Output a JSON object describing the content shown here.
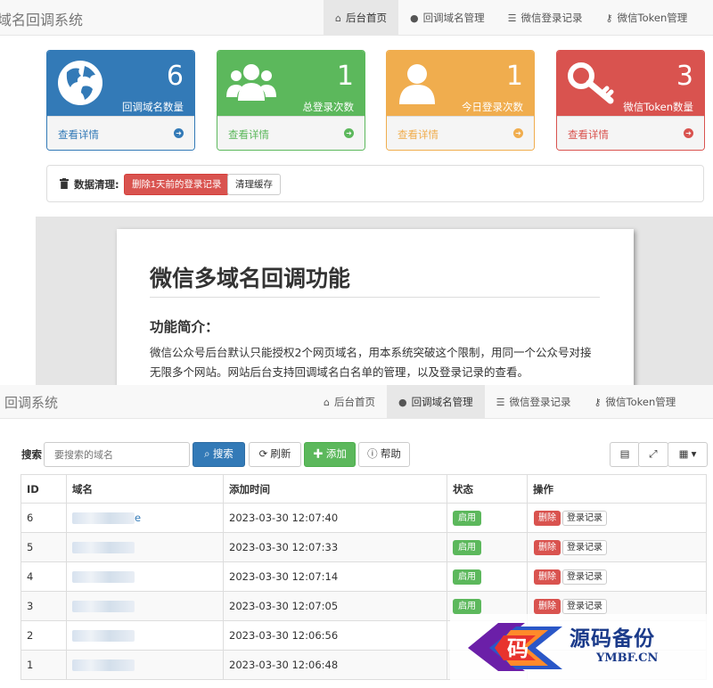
{
  "top": {
    "brand": "域名回调系统",
    "nav": [
      {
        "label": "后台首页",
        "icon": "home-icon",
        "active": true
      },
      {
        "label": "回调域名管理",
        "icon": "globe-icon",
        "active": false
      },
      {
        "label": "微信登录记录",
        "icon": "list-icon",
        "active": false
      },
      {
        "label": "微信Token管理",
        "icon": "key-icon",
        "active": false
      }
    ],
    "stats": [
      {
        "value": "6",
        "label": "回调域名数量",
        "more": "查看详情",
        "icon": "globe-icon",
        "color": "#337ab7"
      },
      {
        "value": "1",
        "label": "总登录次数",
        "more": "查看详情",
        "icon": "users-icon",
        "color": "#5cb85c"
      },
      {
        "value": "1",
        "label": "今日登录次数",
        "more": "查看详情",
        "icon": "user-icon",
        "color": "#f0ad4e"
      },
      {
        "value": "3",
        "label": "微信Token数量",
        "more": "查看详情",
        "icon": "key-icon",
        "color": "#d9534f"
      }
    ],
    "cleanup": {
      "title": "数据清理:",
      "delete_label": "删除1天前的登录记录",
      "clear_cache_label": "清理缓存"
    },
    "doc": {
      "title": "微信多域名回调功能",
      "subtitle": "功能简介：",
      "paragraph": "微信公众号后台默认只能授权2个网页域名，用本系统突破这个限制，用同一个公众号对接无限多个网站。网站后台支持回调域名白名单的管理，以及登录记录的查看。"
    }
  },
  "bottom": {
    "brand": "回调系统",
    "nav": [
      {
        "label": "后台首页",
        "icon": "home-icon",
        "active": false
      },
      {
        "label": "回调域名管理",
        "icon": "globe-icon",
        "active": true
      },
      {
        "label": "微信登录记录",
        "icon": "list-icon",
        "active": false
      },
      {
        "label": "微信Token管理",
        "icon": "key-icon",
        "active": false
      }
    ],
    "toolbar": {
      "search_label": "搜索",
      "search_placeholder": "要搜索的域名",
      "search_button": "搜索",
      "refresh_button": "刷新",
      "add_button": "添加",
      "help_button": "帮助"
    },
    "table": {
      "columns": [
        "ID",
        "域名",
        "添加时间",
        "状态",
        "操作"
      ],
      "rows": [
        {
          "id": "6",
          "domain_suffix": "e",
          "time": "2023-03-30 12:07:40",
          "status": "启用",
          "delete": "删除",
          "logs": "登录记录"
        },
        {
          "id": "5",
          "domain_suffix": "",
          "time": "2023-03-30 12:07:33",
          "status": "启用",
          "delete": "删除",
          "logs": "登录记录"
        },
        {
          "id": "4",
          "domain_suffix": "",
          "time": "2023-03-30 12:07:14",
          "status": "启用",
          "delete": "删除",
          "logs": "登录记录"
        },
        {
          "id": "3",
          "domain_suffix": "",
          "time": "2023-03-30 12:07:05",
          "status": "启用",
          "delete": "删除",
          "logs": "登录记录"
        },
        {
          "id": "2",
          "domain_suffix": "",
          "time": "2023-03-30 12:06:56",
          "status": "",
          "delete": "",
          "logs": ""
        },
        {
          "id": "1",
          "domain_suffix": "",
          "time": "2023-03-30 12:06:48",
          "status": "",
          "delete": "",
          "logs": ""
        }
      ]
    },
    "watermark": {
      "logo_char": "码",
      "text": "源码备份",
      "sub": "YMBF.CN"
    }
  }
}
